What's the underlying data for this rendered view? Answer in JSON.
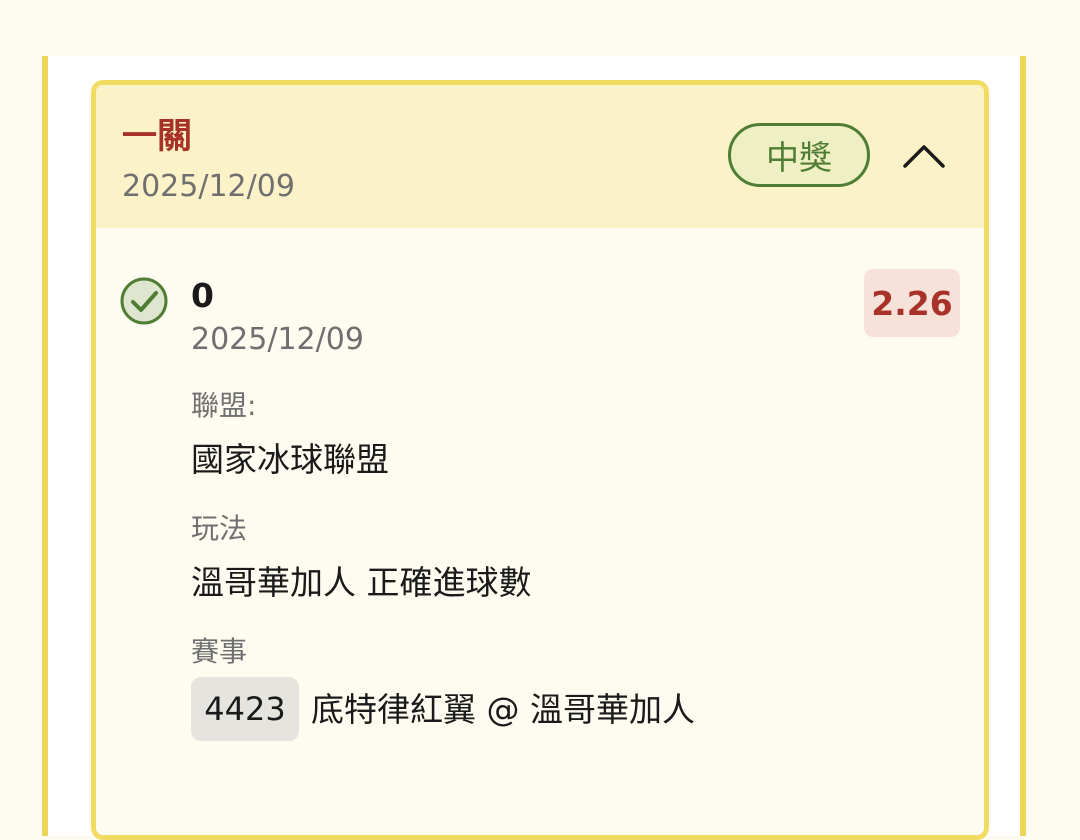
{
  "card": {
    "title": "一關",
    "date": "2025/12/09",
    "status_badge": "中獎"
  },
  "selection": {
    "pick": "0",
    "date": "2025/12/09",
    "odds": "2.26",
    "league_label": "聯盟:",
    "league_value": "國家冰球聯盟",
    "market_label": "玩法",
    "market_value": "溫哥華加人 正確進球數",
    "event_label": "賽事",
    "event_id": "4423",
    "event_name": "底特律紅翼 @ 溫哥華加人"
  },
  "icons": {
    "collapse": "chevron-up-icon",
    "won": "check-circle-icon"
  },
  "colors": {
    "accent_red": "#a8322a",
    "won_green": "#4e7d33",
    "border_yellow": "#f1dc63"
  }
}
